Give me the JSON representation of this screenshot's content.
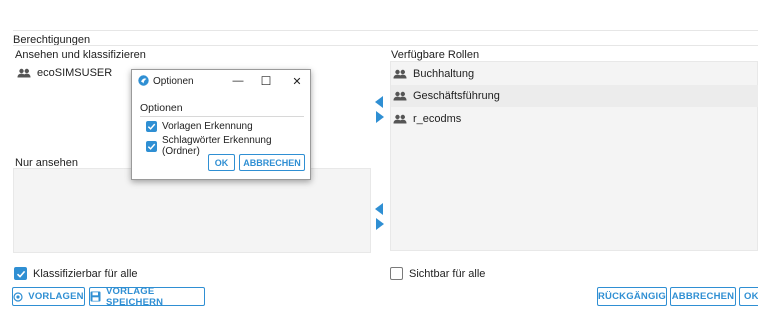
{
  "page": {
    "section_title": "Berechtigungen"
  },
  "left": {
    "view_classify_label": "Ansehen und klassifizieren",
    "view_classify_items": [
      "ecoSIMSUSER"
    ],
    "view_only_label": "Nur ansehen",
    "classifiable_all_label": "Klassifizierbar für alle",
    "classifiable_all_checked": true
  },
  "right": {
    "available_roles_label": "Verfügbare Rollen",
    "roles": [
      "Buchhaltung",
      "Geschäftsführung",
      "r_ecodms"
    ],
    "visible_all_label": "Sichtbar für alle",
    "visible_all_checked": false
  },
  "footer": {
    "templates_label": "VORLAGEN",
    "save_template_label": "VORLAGE SPEICHERN",
    "undo_label": "RÜCKGÄNGIG",
    "cancel_label": "ABBRECHEN",
    "ok_label": "OK"
  },
  "dialog": {
    "title": "Optionen",
    "section_label": "Optionen",
    "options": [
      {
        "label": "Vorlagen Erkennung",
        "checked": true
      },
      {
        "label": "Schlagwörter Erkennung (Ordner)",
        "checked": true
      }
    ],
    "ok_label": "OK",
    "cancel_label": "ABBRECHEN",
    "minimize_glyph": "—",
    "maximize_glyph": "☐",
    "close_glyph": "✕"
  },
  "colors": {
    "accent": "#2f8fd3",
    "panel_bg": "#f4f4f4",
    "highlight_bg": "#ececec"
  },
  "icons": {
    "role": "users-icon",
    "arrow_left": "arrow-left-icon",
    "arrow_right": "arrow-right-icon",
    "templates": "target-icon",
    "save": "floppy-icon"
  }
}
